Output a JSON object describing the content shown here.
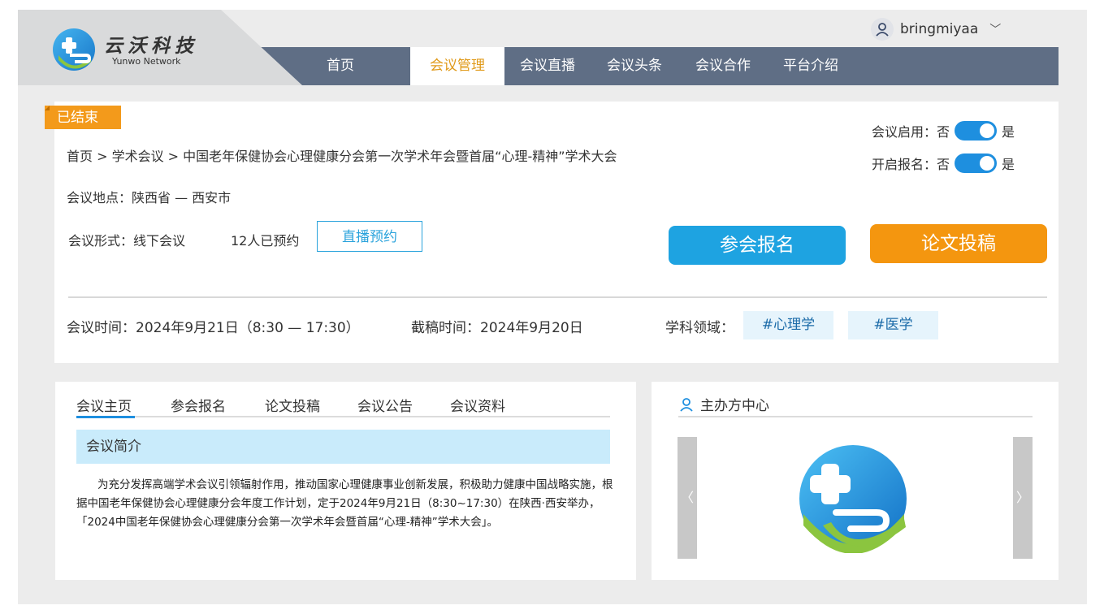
{
  "brand": {
    "name_cn": "云沃科技",
    "name_en": "Yunwo Network"
  },
  "nav": [
    "首页",
    "会议管理",
    "会议直播",
    "会议头条",
    "会议合作",
    "平台介绍"
  ],
  "user": {
    "name": "bringmiyaa"
  },
  "conference": {
    "status": "已结束",
    "breadcrumb": "首页 > 学术会议 > 中国老年保健协会心理健康分会第一次学术年会暨首届“心理-精神”学术大会",
    "location": "会议地点：陕西省 — 西安市",
    "format": "会议形式：线下会议",
    "reserved": "12人已预约",
    "live_button": "直播预约",
    "register_button": "参会报名",
    "submit_button": "论文投稿",
    "toggle_enabled": {
      "label": "会议启用：否",
      "yes": "是",
      "on": true
    },
    "toggle_signup": {
      "label": "开启报名：否",
      "yes": "是",
      "on": true
    },
    "time": "会议时间：2024年9月21日（8:30 — 17:30）",
    "deadline": "截稿时间：2024年9月20日",
    "field_label": "学科领域：",
    "tags": [
      "#心理学",
      "#医学"
    ]
  },
  "tabs": [
    "会议主页",
    "参会报名",
    "论文投稿",
    "会议公告",
    "会议资料"
  ],
  "intro": {
    "heading": "会议简介",
    "text": "为充分发挥高端学术会议引领辐射作用，推动国家心理健康事业创新发展，积极助力健康中国战略实施，根据中国老年保健协会心理健康分会年度工作计划，定于2024年9月21日（8:30~17:30）在陕西·西安举办，「2024中国老年保健协会心理健康分会第一次学术年会暨首届“心理-精神”学术大会」。"
  },
  "organizer": {
    "title": "主办方中心",
    "prev": "〈",
    "next": "〉"
  },
  "colors": {
    "nav": "#5f6e85",
    "accent_orange": "#f4960f",
    "accent_blue": "#1ea3e1"
  }
}
